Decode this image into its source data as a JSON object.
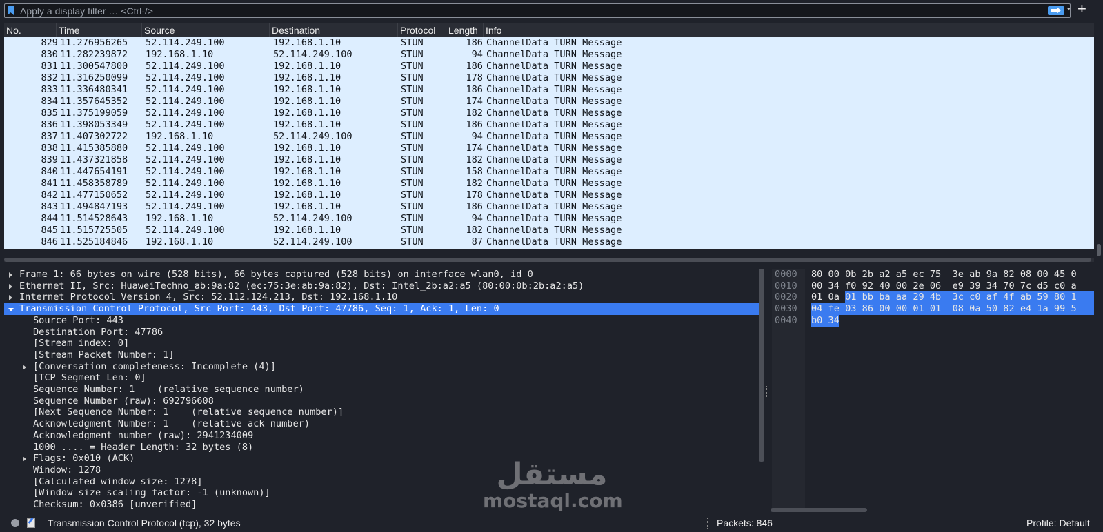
{
  "filter": {
    "placeholder": "Apply a display filter … <Ctrl-/>",
    "add_label": "+"
  },
  "columns": {
    "no": "No.",
    "time": "Time",
    "source": "Source",
    "destination": "Destination",
    "protocol": "Protocol",
    "length": "Length",
    "info": "Info"
  },
  "packets": [
    {
      "no": "829",
      "time": "11.276956265",
      "src": "52.114.249.100",
      "dst": "192.168.1.10",
      "proto": "STUN",
      "len": "186",
      "info": "ChannelData TURN Message"
    },
    {
      "no": "830",
      "time": "11.282239872",
      "src": "192.168.1.10",
      "dst": "52.114.249.100",
      "proto": "STUN",
      "len": "94",
      "info": "ChannelData TURN Message"
    },
    {
      "no": "831",
      "time": "11.300547800",
      "src": "52.114.249.100",
      "dst": "192.168.1.10",
      "proto": "STUN",
      "len": "186",
      "info": "ChannelData TURN Message"
    },
    {
      "no": "832",
      "time": "11.316250099",
      "src": "52.114.249.100",
      "dst": "192.168.1.10",
      "proto": "STUN",
      "len": "178",
      "info": "ChannelData TURN Message"
    },
    {
      "no": "833",
      "time": "11.336480341",
      "src": "52.114.249.100",
      "dst": "192.168.1.10",
      "proto": "STUN",
      "len": "186",
      "info": "ChannelData TURN Message"
    },
    {
      "no": "834",
      "time": "11.357645352",
      "src": "52.114.249.100",
      "dst": "192.168.1.10",
      "proto": "STUN",
      "len": "174",
      "info": "ChannelData TURN Message"
    },
    {
      "no": "835",
      "time": "11.375199059",
      "src": "52.114.249.100",
      "dst": "192.168.1.10",
      "proto": "STUN",
      "len": "182",
      "info": "ChannelData TURN Message"
    },
    {
      "no": "836",
      "time": "11.398053349",
      "src": "52.114.249.100",
      "dst": "192.168.1.10",
      "proto": "STUN",
      "len": "186",
      "info": "ChannelData TURN Message"
    },
    {
      "no": "837",
      "time": "11.407302722",
      "src": "192.168.1.10",
      "dst": "52.114.249.100",
      "proto": "STUN",
      "len": "94",
      "info": "ChannelData TURN Message"
    },
    {
      "no": "838",
      "time": "11.415385880",
      "src": "52.114.249.100",
      "dst": "192.168.1.10",
      "proto": "STUN",
      "len": "174",
      "info": "ChannelData TURN Message"
    },
    {
      "no": "839",
      "time": "11.437321858",
      "src": "52.114.249.100",
      "dst": "192.168.1.10",
      "proto": "STUN",
      "len": "182",
      "info": "ChannelData TURN Message"
    },
    {
      "no": "840",
      "time": "11.447654191",
      "src": "52.114.249.100",
      "dst": "192.168.1.10",
      "proto": "STUN",
      "len": "158",
      "info": "ChannelData TURN Message"
    },
    {
      "no": "841",
      "time": "11.458358789",
      "src": "52.114.249.100",
      "dst": "192.168.1.10",
      "proto": "STUN",
      "len": "182",
      "info": "ChannelData TURN Message"
    },
    {
      "no": "842",
      "time": "11.477150652",
      "src": "52.114.249.100",
      "dst": "192.168.1.10",
      "proto": "STUN",
      "len": "178",
      "info": "ChannelData TURN Message"
    },
    {
      "no": "843",
      "time": "11.494847193",
      "src": "52.114.249.100",
      "dst": "192.168.1.10",
      "proto": "STUN",
      "len": "186",
      "info": "ChannelData TURN Message"
    },
    {
      "no": "844",
      "time": "11.514528643",
      "src": "192.168.1.10",
      "dst": "52.114.249.100",
      "proto": "STUN",
      "len": "94",
      "info": "ChannelData TURN Message"
    },
    {
      "no": "845",
      "time": "11.515725505",
      "src": "52.114.249.100",
      "dst": "192.168.1.10",
      "proto": "STUN",
      "len": "182",
      "info": "ChannelData TURN Message"
    },
    {
      "no": "846",
      "time": "11.525184846",
      "src": "192.168.1.10",
      "dst": "52.114.249.100",
      "proto": "STUN",
      "len": "87",
      "info": "ChannelData TURN Message"
    }
  ],
  "details": [
    {
      "text": "Frame 1: 66 bytes on wire (528 bits), 66 bytes captured (528 bits) on interface wlan0, id 0",
      "level": 0,
      "expander": "right",
      "selected": false
    },
    {
      "text": "Ethernet II, Src: HuaweiTechno_ab:9a:82 (ec:75:3e:ab:9a:82), Dst: Intel_2b:a2:a5 (80:00:0b:2b:a2:a5)",
      "level": 0,
      "expander": "right",
      "selected": false
    },
    {
      "text": "Internet Protocol Version 4, Src: 52.112.124.213, Dst: 192.168.1.10",
      "level": 0,
      "expander": "right",
      "selected": false
    },
    {
      "text": "Transmission Control Protocol, Src Port: 443, Dst Port: 47786, Seq: 1, Ack: 1, Len: 0",
      "level": 0,
      "expander": "down",
      "selected": true
    },
    {
      "text": "Source Port: 443",
      "level": 1,
      "expander": "none",
      "selected": false
    },
    {
      "text": "Destination Port: 47786",
      "level": 1,
      "expander": "none",
      "selected": false
    },
    {
      "text": "[Stream index: 0]",
      "level": 1,
      "expander": "none",
      "selected": false
    },
    {
      "text": "[Stream Packet Number: 1]",
      "level": 1,
      "expander": "none",
      "selected": false
    },
    {
      "text": "[Conversation completeness: Incomplete (4)]",
      "level": 1,
      "expander": "right",
      "selected": false
    },
    {
      "text": "[TCP Segment Len: 0]",
      "level": 1,
      "expander": "none",
      "selected": false
    },
    {
      "text": "Sequence Number: 1    (relative sequence number)",
      "level": 1,
      "expander": "none",
      "selected": false
    },
    {
      "text": "Sequence Number (raw): 692796608",
      "level": 1,
      "expander": "none",
      "selected": false
    },
    {
      "text": "[Next Sequence Number: 1    (relative sequence number)]",
      "level": 1,
      "expander": "none",
      "selected": false
    },
    {
      "text": "Acknowledgment Number: 1    (relative ack number)",
      "level": 1,
      "expander": "none",
      "selected": false
    },
    {
      "text": "Acknowledgment number (raw): 2941234009",
      "level": 1,
      "expander": "none",
      "selected": false
    },
    {
      "text": "1000 .... = Header Length: 32 bytes (8)",
      "level": 1,
      "expander": "none",
      "selected": false
    },
    {
      "text": "Flags: 0x010 (ACK)",
      "level": 1,
      "expander": "right",
      "selected": false
    },
    {
      "text": "Window: 1278",
      "level": 1,
      "expander": "none",
      "selected": false
    },
    {
      "text": "[Calculated window size: 1278]",
      "level": 1,
      "expander": "none",
      "selected": false
    },
    {
      "text": "[Window size scaling factor: -1 (unknown)]",
      "level": 1,
      "expander": "none",
      "selected": false
    },
    {
      "text": "Checksum: 0x0386 [unverified]",
      "level": 1,
      "expander": "none",
      "selected": false
    }
  ],
  "bytes": [
    {
      "offset": "0000",
      "hex": "80 00 0b 2b a2 a5 ec 75  3e ab 9a 82 08 00 45 0"
    },
    {
      "offset": "0010",
      "hex": "00 34 f0 92 40 00 2e 06  e9 39 34 70 7c d5 c0 a"
    },
    {
      "offset": "0020",
      "hex": "01 0a 01 bb ba aa 29 4b  3c c0 af 4f ab 59 80 1"
    },
    {
      "offset": "0030",
      "hex": "04 fe 03 86 00 00 01 01  08 0a 50 82 e4 1a 99 5"
    },
    {
      "offset": "0040",
      "hex": "b0 34"
    }
  ],
  "watermark": {
    "arabic": "مستقل",
    "latin": "mostaql.com"
  },
  "status": {
    "text": "Transmission Control Protocol (tcp), 32 bytes",
    "packets": "Packets: 846",
    "profile": "Profile: Default"
  },
  "colors": {
    "row_bg": "#ddeeff",
    "selected": "#3a7bf0",
    "background": "#1f222a"
  }
}
